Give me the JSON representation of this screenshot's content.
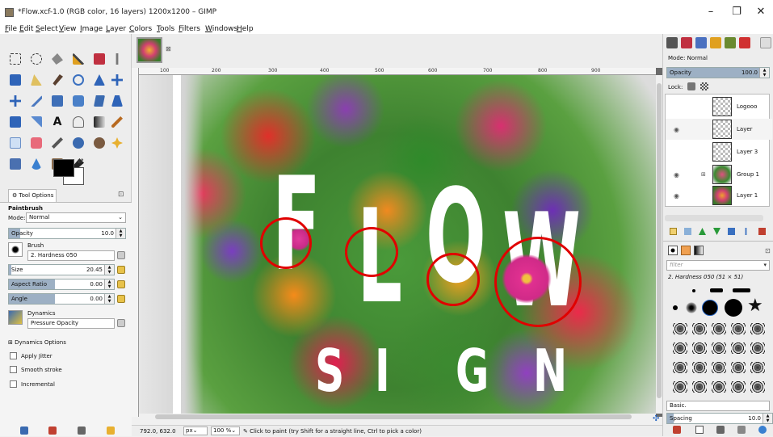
{
  "window": {
    "title": "*Flow.xcf-1.0 (RGB color, 16 layers) 1200x1200 – GIMP",
    "minimize": "–",
    "maximize": "❐",
    "close": "✕"
  },
  "menu": [
    "File",
    "Edit",
    "Select",
    "View",
    "Image",
    "Layer",
    "Colors",
    "Tools",
    "Filters",
    "Windows",
    "Help"
  ],
  "tool_options": {
    "tab_label": "Tool Options",
    "tool_name": "Paintbrush",
    "mode_label": "Mode:",
    "mode_value": "Normal",
    "opacity_label": "Opacity",
    "opacity_value": "10.0",
    "opacity_fraction": 0.1,
    "brush_label": "Brush",
    "brush_value": "2. Hardness 050",
    "size_label": "Size",
    "size_value": "20.45",
    "aspect_label": "Aspect Ratio",
    "aspect_value": "0.00",
    "angle_label": "Angle",
    "angle_value": "0.00",
    "dynamics_label": "Dynamics",
    "dynamics_value": "Pressure Opacity",
    "dynamics_options": "Dynamics Options",
    "apply_jitter": "Apply Jitter",
    "smooth_stroke": "Smooth stroke",
    "incremental": "Incremental"
  },
  "ruler": {
    "ticks": [
      "100",
      "200",
      "300",
      "400",
      "500",
      "600",
      "700",
      "800",
      "900"
    ]
  },
  "canvas_text": {
    "letters_top": [
      "F",
      "L",
      "O",
      "W"
    ],
    "letters_bottom": [
      "S",
      "I",
      "G",
      "N"
    ]
  },
  "status": {
    "coords": "792.0, 632.0",
    "unit": "px",
    "zoom": "100 %",
    "message": "Click to paint (try Shift for a straight line, Ctrl to pick a color)"
  },
  "layers": {
    "mode_label": "Mode:",
    "mode_value": "Normal",
    "opacity_label": "Opacity",
    "opacity_value": "100.0",
    "lock_label": "Lock:",
    "items": [
      {
        "name": "Logooo"
      },
      {
        "name": "Layer"
      },
      {
        "name": "Layer 3"
      },
      {
        "name": "Group 1"
      },
      {
        "name": "Layer 1"
      }
    ]
  },
  "brushes": {
    "filter_placeholder": "filter",
    "selected": "2. Hardness 050 (51 × 51)",
    "preset": "Basic.",
    "spacing_label": "Spacing",
    "spacing_value": "10.0"
  },
  "colors": {
    "accent": "#e00000",
    "slider_fill": "#9db0c4"
  }
}
